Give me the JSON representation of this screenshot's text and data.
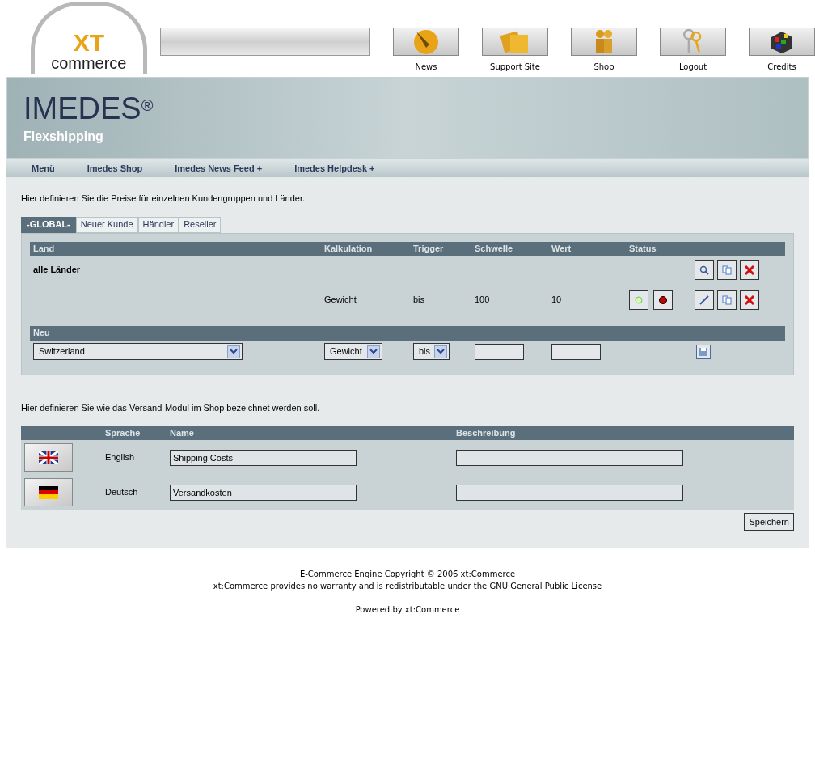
{
  "logo": {
    "letters": "XT",
    "word": "commerce"
  },
  "top_nav": [
    {
      "label": "News",
      "kind": "news"
    },
    {
      "label": "Support Site",
      "kind": "support"
    },
    {
      "label": "Shop",
      "kind": "shop"
    },
    {
      "label": "Logout",
      "kind": "logout"
    },
    {
      "label": "Credits",
      "kind": "credits"
    }
  ],
  "banner": {
    "brand": "IMEDES",
    "mark": "®",
    "subtitle": "Flexshipping"
  },
  "menu": [
    "Menü",
    "Imedes Shop",
    "Imedes News Feed +",
    "Imedes Helpdesk +"
  ],
  "intro": "Hier definieren Sie die Preise für einzelnen Kundengruppen und Länder.",
  "tabs": [
    {
      "label": "-GLOBAL-",
      "selected": true
    },
    {
      "label": "Neuer Kunde",
      "selected": false
    },
    {
      "label": "Händler",
      "selected": false
    },
    {
      "label": "Reseller",
      "selected": false
    }
  ],
  "rates": {
    "columns": [
      "Land",
      "Kalkulation",
      "Trigger",
      "Schwelle",
      "Wert",
      "Status"
    ],
    "group": "alle Länder",
    "rows": [
      {
        "kalkulation": "Gewicht",
        "trigger": "bis",
        "schwelle": "100",
        "wert": "10"
      }
    ],
    "new_header": "Neu",
    "new": {
      "country": "Switzerland",
      "kalkulation": "Gewicht",
      "trigger": "bis"
    }
  },
  "names_intro": "Hier definieren Sie wie das Versand-Modul im Shop bezeichnet werden soll.",
  "names": {
    "columns": [
      "Sprache",
      "Name",
      "Beschreibung"
    ],
    "rows": [
      {
        "kind": "uk",
        "language": "English",
        "name": "Shipping Costs"
      },
      {
        "kind": "de",
        "language": "Deutsch",
        "name": "Versandkosten"
      }
    ]
  },
  "save": "Speichern",
  "footer": [
    "E-Commerce Engine Copyright © 2006 xt:Commerce",
    "xt:Commerce provides no warranty and is redistributable under the GNU General Public License",
    "Powered by xt:Commerce"
  ]
}
